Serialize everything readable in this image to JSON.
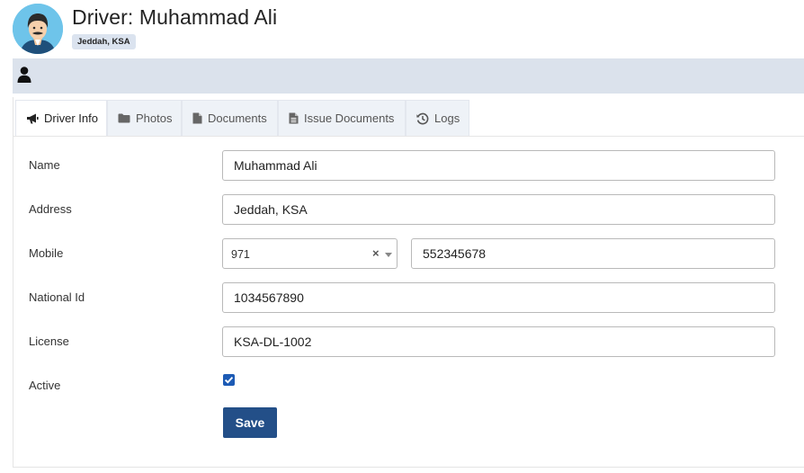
{
  "header": {
    "title": "Driver: Muhammad Ali",
    "location_badge": "Jeddah, KSA"
  },
  "tabs": [
    {
      "label": "Driver Info",
      "icon": "bullhorn-icon",
      "active": true
    },
    {
      "label": "Photos",
      "icon": "folder-icon",
      "active": false
    },
    {
      "label": "Documents",
      "icon": "file-icon",
      "active": false
    },
    {
      "label": "Issue Documents",
      "icon": "file-text-icon",
      "active": false
    },
    {
      "label": "Logs",
      "icon": "history-icon",
      "active": false
    }
  ],
  "form": {
    "name": {
      "label": "Name",
      "value": "Muhammad Ali"
    },
    "address": {
      "label": "Address",
      "value": "Jeddah, KSA"
    },
    "mobile": {
      "label": "Mobile",
      "country_code": "971",
      "number": "552345678",
      "clear_symbol": "×"
    },
    "national_id": {
      "label": "National Id",
      "value": "1034567890"
    },
    "license": {
      "label": "License",
      "value": "KSA-DL-1002"
    },
    "active": {
      "label": "Active",
      "checked": true
    },
    "save_label": "Save"
  },
  "colors": {
    "accent": "#234f88",
    "checkbox": "#1d5bb5",
    "user_bar": "#dbe2ec",
    "avatar_bg": "#6ec4ea"
  }
}
